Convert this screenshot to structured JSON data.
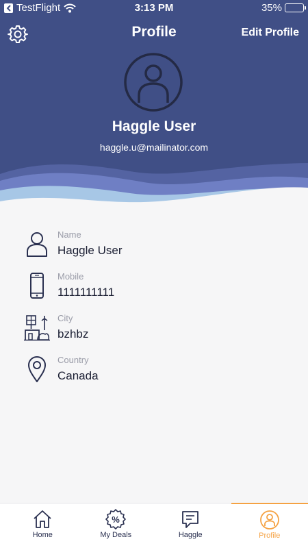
{
  "status_bar": {
    "back_app": "TestFlight",
    "time": "3:13 PM",
    "battery": "35%",
    "battery_level": 0.35
  },
  "nav": {
    "title": "Profile",
    "edit_label": "Edit Profile",
    "settings_icon": "gear-icon"
  },
  "profile": {
    "name": "Haggle User",
    "email": "haggle.u@mailinator.com",
    "avatar_icon": "user-avatar-icon"
  },
  "info": {
    "items": [
      {
        "label": "Name",
        "value": "Haggle User",
        "icon": "person-icon"
      },
      {
        "label": "Mobile",
        "value": "1111111111",
        "icon": "mobile-phone-icon"
      },
      {
        "label": "City",
        "value": "bzhbz",
        "icon": "city-icon"
      },
      {
        "label": "Country",
        "value": "Canada",
        "icon": "location-pin-icon"
      }
    ]
  },
  "tabbar": {
    "tabs": [
      {
        "label": "Home",
        "icon": "home-icon",
        "active": false
      },
      {
        "label": "My Deals",
        "icon": "percent-badge-icon",
        "active": false
      },
      {
        "label": "Haggle",
        "icon": "chat-icon",
        "active": false
      },
      {
        "label": "Profile",
        "icon": "profile-icon",
        "active": true
      }
    ]
  },
  "colors": {
    "header_bg": "#404f86",
    "accent": "#f5a243",
    "icon_dark": "#2a3050"
  }
}
